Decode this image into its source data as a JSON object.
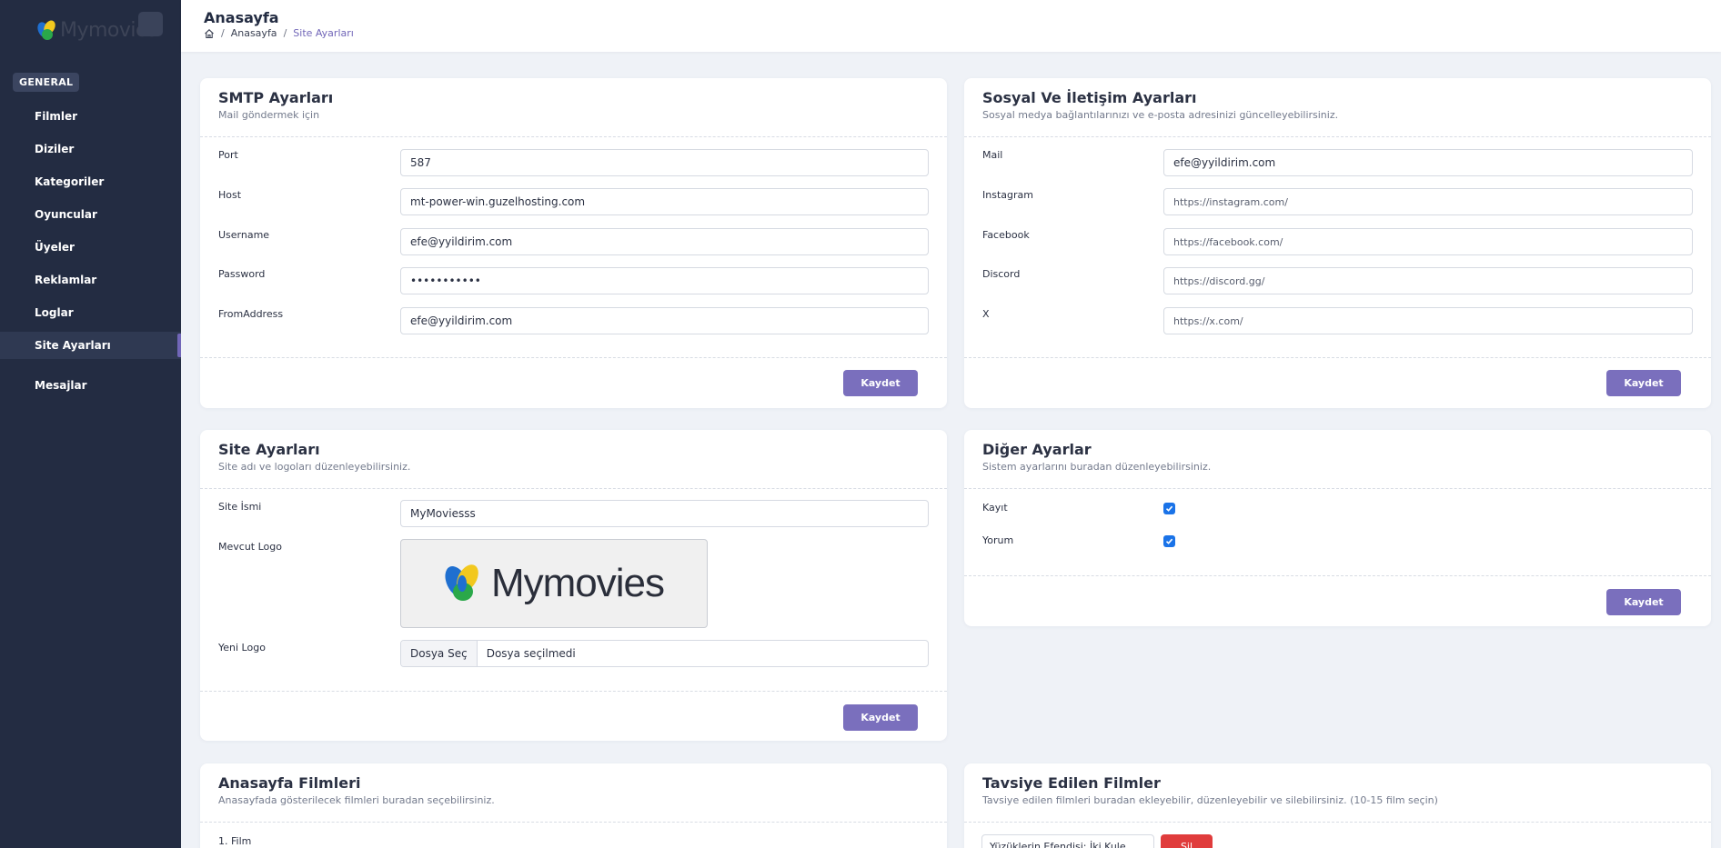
{
  "brand": {
    "name": "Mymovies"
  },
  "sidebar": {
    "section": "GENERAL",
    "items": [
      {
        "label": "Filmler"
      },
      {
        "label": "Diziler"
      },
      {
        "label": "Kategoriler"
      },
      {
        "label": "Oyuncular"
      },
      {
        "label": "Üyeler"
      },
      {
        "label": "Reklamlar"
      },
      {
        "label": "Loglar"
      },
      {
        "label": "Site Ayarları"
      },
      {
        "label": "Mesajlar"
      }
    ],
    "active": "Site Ayarları"
  },
  "header": {
    "title": "Anasayfa",
    "breadcrumb": [
      "Anasayfa",
      "Site Ayarları"
    ]
  },
  "smtp": {
    "title": "SMTP Ayarları",
    "subtitle": "Mail göndermek için",
    "fields": [
      {
        "label": "Port",
        "value": "587"
      },
      {
        "label": "Host",
        "value": "mt-power-win.guzelhosting.com"
      },
      {
        "label": "Username",
        "value": "efe@yyildirim.com"
      },
      {
        "label": "Password",
        "value": "•••••••••••"
      },
      {
        "label": "FromAddress",
        "value": "efe@yyildirim.com"
      }
    ],
    "save": "Kaydet"
  },
  "social": {
    "title": "Sosyal Ve İletişim Ayarları",
    "subtitle": "Sosyal medya bağlantılarınızı ve e-posta adresinizi güncelleyebilirsiniz.",
    "fields": [
      {
        "label": "Mail",
        "value": "efe@yyildirim.com"
      },
      {
        "label": "Instagram",
        "placeholder": "https://instagram.com/"
      },
      {
        "label": "Facebook",
        "placeholder": "https://facebook.com/"
      },
      {
        "label": "Discord",
        "placeholder": "https://discord.gg/"
      },
      {
        "label": "X",
        "placeholder": "https://x.com/"
      }
    ],
    "save": "Kaydet"
  },
  "site": {
    "title": "Site Ayarları",
    "subtitle": "Site adı ve logoları düzenleyebilirsiniz.",
    "name_label": "Site İsmi",
    "name_value": "MyMoviesss",
    "logo_label": "Mevcut Logo",
    "logo_text": "Mymovies",
    "new_logo_label": "Yeni Logo",
    "file_button": "Dosya Seç",
    "file_status": "Dosya seçilmedi",
    "save": "Kaydet"
  },
  "other": {
    "title": "Diğer Ayarlar",
    "subtitle": "Sistem ayarlarını buradan düzenleyebilirsiniz.",
    "options": [
      {
        "label": "Kayıt",
        "checked": true
      },
      {
        "label": "Yorum",
        "checked": true
      }
    ],
    "save": "Kaydet"
  },
  "home_movies": {
    "title": "Anasayfa Filmleri",
    "subtitle": "Anasayfada gösterilecek filmleri buradan seçebilirsiniz.",
    "first_label": "1. Film"
  },
  "recommended": {
    "title": "Tavsiye Edilen Filmler",
    "subtitle": "Tavsiye edilen filmleri buradan ekleyebilir, düzenleyebilir ve silebilirsiniz. (10-15 film seçin)",
    "first_select": "Yüzüklerin Efendisi: İki Kule",
    "delete_label": "Sil"
  },
  "colors": {
    "accent": "#7a6fbd",
    "sidebar": "#232c42",
    "danger": "#e03c3c",
    "checkbox": "#1a73e8"
  },
  "icons": {
    "home": "home-icon",
    "check": "check-icon"
  }
}
